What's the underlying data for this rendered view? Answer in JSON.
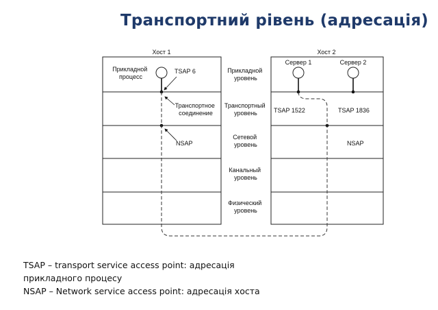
{
  "slide": {
    "title": "Транспортний рівень (адресація)"
  },
  "diagram": {
    "host1_label": "Хост 1",
    "host2_label": "Хост 2",
    "layers": [
      [
        "Прикладной",
        "уровень"
      ],
      [
        "Транспортный",
        "уровень"
      ],
      [
        "Сетевой",
        "уровень"
      ],
      [
        "Канальный",
        "уровень"
      ],
      [
        "Физический",
        "уровень"
      ]
    ],
    "host1": {
      "app_process": [
        "Прикладной",
        "процесс"
      ],
      "tsap": "TSAP 6",
      "transport_connection": [
        "Транспортное",
        "соединение"
      ],
      "nsap": "NSAP"
    },
    "host2": {
      "server1": "Сервер 1",
      "server2": "Сервер 2",
      "tsap1": "TSAP 1522",
      "tsap2": "TSAP 1836",
      "nsap": "NSAP"
    }
  },
  "footer": {
    "line1": "TSAP – transport service access point: адресація",
    "line2": "прикладного процесу",
    "line3": "NSAP – Network service access point: адресація хоста"
  }
}
